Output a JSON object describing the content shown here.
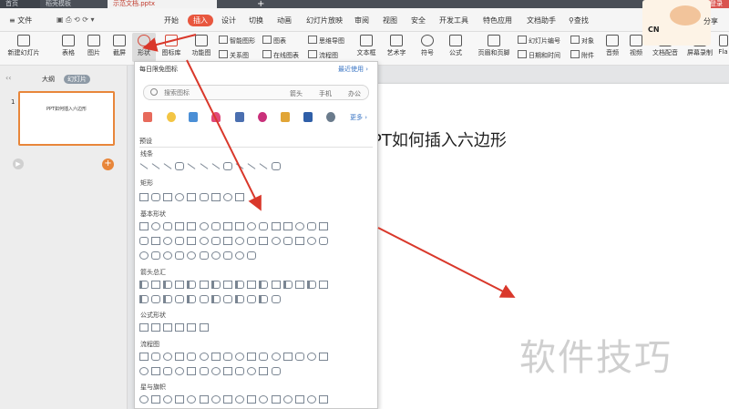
{
  "titlebar": {
    "tabs": [
      {
        "label": "首页"
      },
      {
        "label": "稻壳模板"
      },
      {
        "label": "示范文档.pptx"
      }
    ],
    "login_label": "访客登录",
    "new_tab_label": "+"
  },
  "menubar": {
    "file_label": "文件",
    "items": [
      "开始",
      "插入",
      "设计",
      "切换",
      "动画",
      "幻灯片放映",
      "审阅",
      "视图",
      "安全",
      "开发工具",
      "特色应用",
      "文档助手"
    ],
    "search_label": "查找",
    "share_label": "分享"
  },
  "ribbon": {
    "new_slide": "新建幻灯片",
    "table": "表格",
    "picture": "图片",
    "screenshot": "截屏",
    "shape": "形状",
    "icon_lib": "图标库",
    "function_chart": "功能图",
    "smart_graphic": "智能图形",
    "relation_chart": "关系图",
    "chart": "图表",
    "online_chart": "在线图表",
    "mind_map": "思维导图",
    "flow_chart": "流程图",
    "textbox": "文本框",
    "art_text": "艺术字",
    "symbol": "符号",
    "formula": "公式",
    "header_footer": "页眉和页脚",
    "slide_number": "幻灯片编号",
    "date_time": "日期和时间",
    "object": "对象",
    "attachment": "附件",
    "audio": "音频",
    "video": "视频",
    "doc_voice": "文档配音",
    "screen_record": "屏幕录制",
    "flash": "Fla"
  },
  "left_panel": {
    "outline_tab": "大纲",
    "slides_tab": "幻灯片",
    "slide_number": "1",
    "thumb_title": "PPT如何插入六边形"
  },
  "slide": {
    "title": "PT如何插入六边形"
  },
  "watermark": "软件技巧",
  "brand": {
    "label": "CN"
  },
  "shape_panel": {
    "title": "每日限免图标",
    "more_link": "最近使用",
    "search_placeholder": "搜索图标",
    "tags": [
      "箭头",
      "手机",
      "办公"
    ],
    "featured_more": "更多",
    "preset_label": "预设",
    "sections": [
      {
        "label": "线条",
        "count": 12
      },
      {
        "label": "矩形",
        "count": 9
      },
      {
        "label": "基本形状",
        "count": 42
      },
      {
        "label": "箭头总汇",
        "count": 28
      },
      {
        "label": "公式形状",
        "count": 6
      },
      {
        "label": "流程图",
        "count": 28
      },
      {
        "label": "星与旗帜",
        "count": 16
      }
    ]
  },
  "colors": {
    "accent": "#e8573f",
    "arrow": "#d9382b",
    "link": "#3a75c4"
  }
}
